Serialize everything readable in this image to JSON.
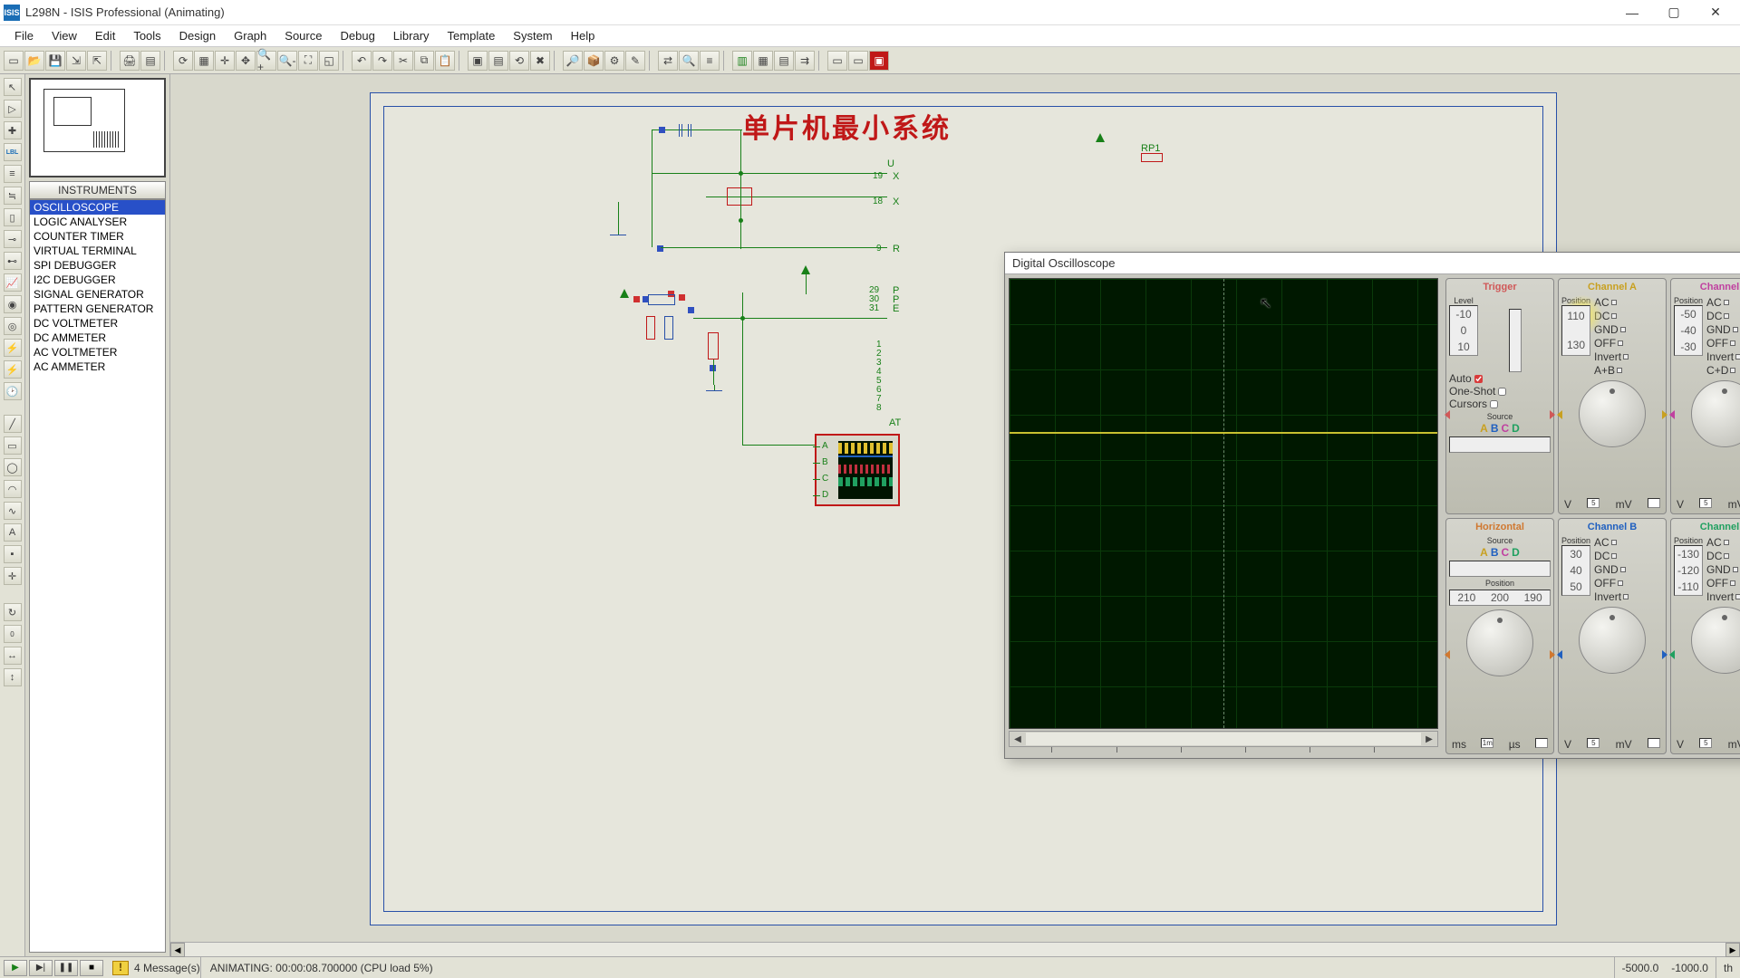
{
  "window": {
    "app_icon": "ISIS",
    "title": "L298N - ISIS Professional (Animating)"
  },
  "menus": [
    "File",
    "View",
    "Edit",
    "Tools",
    "Design",
    "Graph",
    "Source",
    "Debug",
    "Library",
    "Template",
    "System",
    "Help"
  ],
  "sidebar": {
    "header": "INSTRUMENTS",
    "items": [
      "OSCILLOSCOPE",
      "LOGIC ANALYSER",
      "COUNTER TIMER",
      "VIRTUAL TERMINAL",
      "SPI DEBUGGER",
      "I2C DEBUGGER",
      "SIGNAL GENERATOR",
      "PATTERN GENERATOR",
      "DC VOLTMETER",
      "DC AMMETER",
      "AC VOLTMETER",
      "AC AMMETER"
    ],
    "selected_index": 0
  },
  "schematic": {
    "title": "单片机最小系统",
    "rp1": "RP1",
    "pins_left_top": [
      "19",
      "18",
      "9"
    ],
    "pins_left_mid": [
      "29",
      "30",
      "31"
    ],
    "pins_left_low": [
      "1",
      "2",
      "3",
      "4",
      "5",
      "6",
      "7",
      "8"
    ],
    "u_label": "U",
    "x_labels": [
      "X",
      "X"
    ],
    "rst": "R",
    "ports": "P",
    "at": "AT"
  },
  "scope_comp": {
    "ports": [
      "A",
      "B",
      "C",
      "D"
    ]
  },
  "oscilloscope": {
    "title": "Digital Oscilloscope",
    "trigger": {
      "label": "Trigger",
      "level": "Level",
      "level_vals": [
        "-10",
        "0",
        "10"
      ],
      "auto": "Auto",
      "oneshot": "One-Shot",
      "cursors": "Cursors",
      "source": "Source",
      "srcA": "A",
      "srcB": "B",
      "srcC": "C",
      "srcD": "D"
    },
    "horizontal": {
      "label": "Horizontal",
      "source": "Source",
      "position": "Position",
      "pos_vals": [
        "210",
        "200",
        "190"
      ],
      "dial_left": "200",
      "dial_top": "0.5",
      "unit_l": "ms",
      "box_l": "1m",
      "unit_r": "µs",
      "box_r": ""
    },
    "channels": {
      "A": {
        "label": "Channel A",
        "position": "Position",
        "pos_vals": [
          "110",
          "",
          "130"
        ],
        "ac": "AC",
        "dc": "DC",
        "gnd": "GND",
        "off": "OFF",
        "invert": "Invert",
        "ab": "A+B",
        "scale_v": "V",
        "box_l": "5",
        "scale_mv": "mV",
        "box_r": ""
      },
      "B": {
        "label": "Channel B",
        "position": "Position",
        "pos_vals": [
          "30",
          "40",
          "50"
        ],
        "ac": "AC",
        "dc": "DC",
        "gnd": "GND",
        "off": "OFF",
        "invert": "Invert",
        "scale_v": "V",
        "box_l": "5",
        "scale_mv": "mV",
        "box_r": ""
      },
      "C": {
        "label": "Channel C",
        "position": "Position",
        "pos_vals": [
          "-50",
          "-40",
          "-30"
        ],
        "ac": "AC",
        "dc": "DC",
        "gnd": "GND",
        "off": "OFF",
        "invert": "Invert",
        "cd": "C+D",
        "scale_v": "V",
        "box_l": "5",
        "scale_mv": "mV",
        "box_r": ""
      },
      "D": {
        "label": "Channel D",
        "position": "Position",
        "pos_vals": [
          "-130",
          "-120",
          "-110"
        ],
        "ac": "AC",
        "dc": "DC",
        "gnd": "GND",
        "off": "OFF",
        "invert": "Invert",
        "scale_v": "V",
        "box_l": "5",
        "scale_mv": "mV",
        "box_r": ""
      }
    }
  },
  "status": {
    "messages": "4 Message(s)",
    "anim": "ANIMATING: 00:00:08.700000 (CPU load 5%)",
    "coord_x": "-5000.0",
    "coord_y": "-1000.0",
    "unit": "th"
  }
}
